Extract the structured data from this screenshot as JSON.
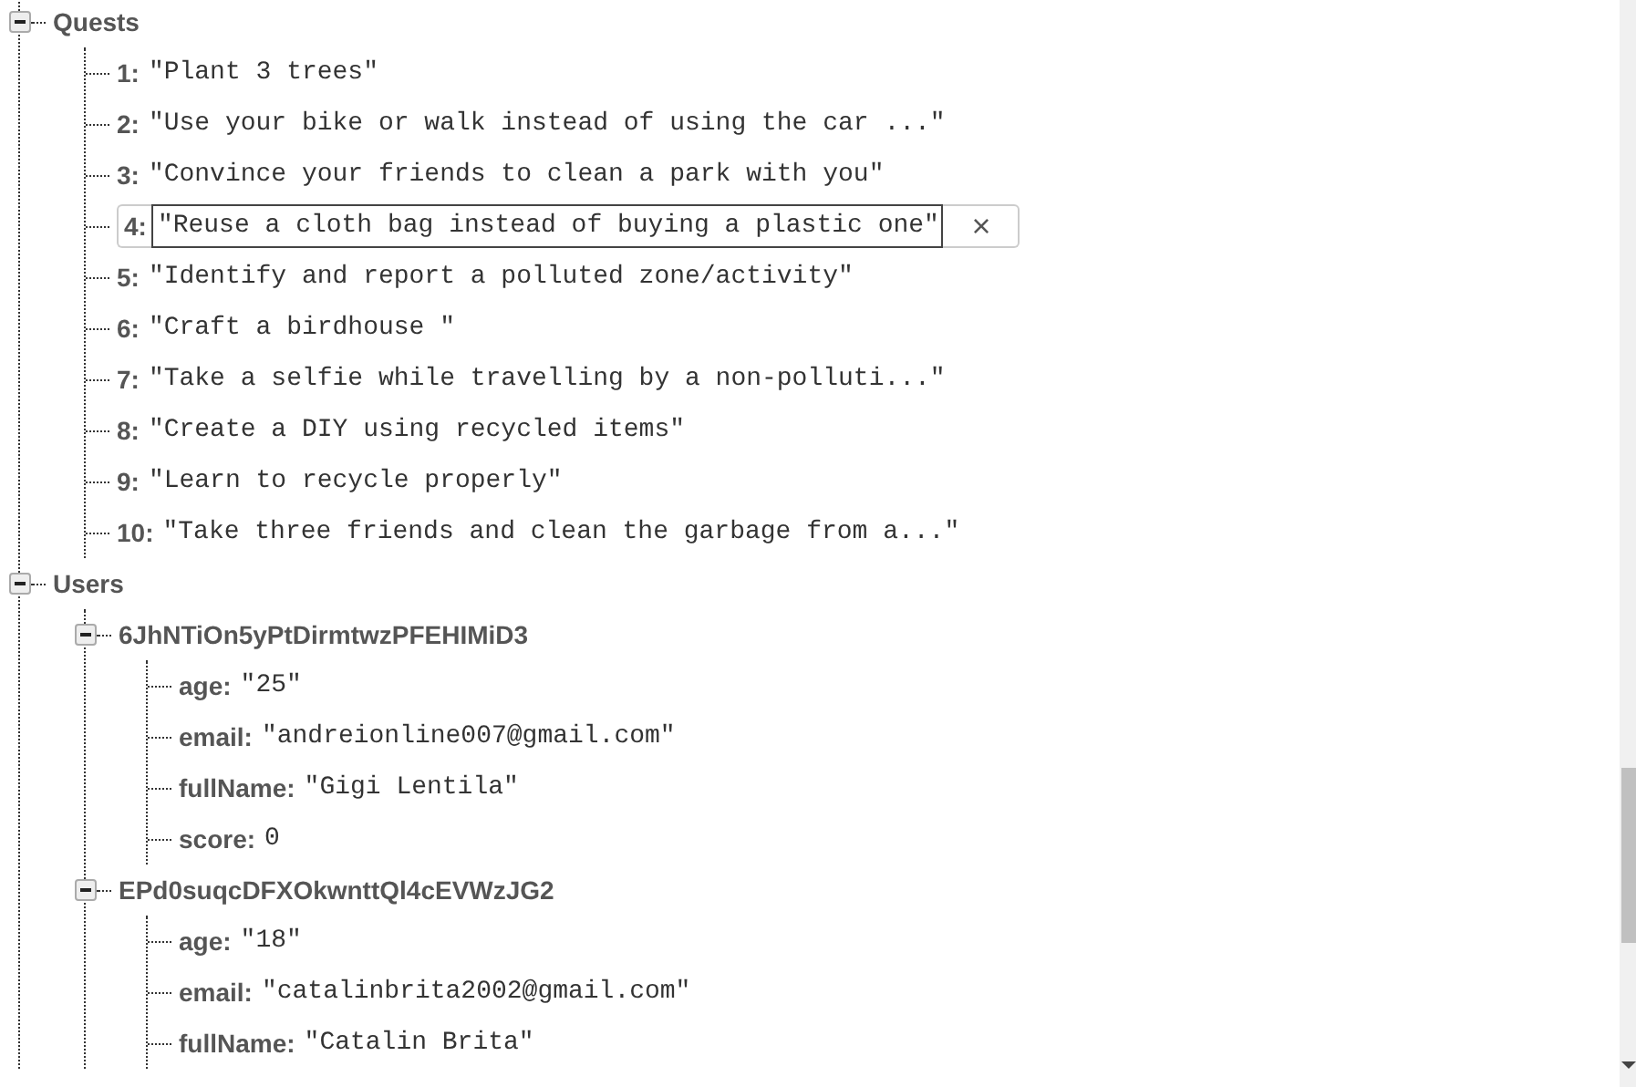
{
  "tree": [
    {
      "key": "Quests",
      "expanded": true,
      "children": [
        {
          "key": "1:",
          "value": "\"Plant 3 trees\"",
          "editing": false
        },
        {
          "key": "2:",
          "value": "\"Use your bike or walk instead of using the car ...\"",
          "editing": false
        },
        {
          "key": "3:",
          "value": "\"Convince your friends to clean a park with you\"",
          "editing": false
        },
        {
          "key": "4:",
          "value": "\"Reuse a cloth bag instead of buying a plastic one\"",
          "editing": true,
          "cancel": "×"
        },
        {
          "key": "5:",
          "value": "\"Identify and report a polluted zone/activity\"",
          "editing": false
        },
        {
          "key": "6:",
          "value": "\"Craft a birdhouse \"",
          "editing": false
        },
        {
          "key": "7:",
          "value": "\"Take a selfie while travelling by a non-polluti...\"",
          "editing": false
        },
        {
          "key": "8:",
          "value": "\"Create a DIY using recycled items\"",
          "editing": false
        },
        {
          "key": "9:",
          "value": "\"Learn to recycle properly\"",
          "editing": false
        },
        {
          "key": "10:",
          "value": "\"Take three friends and clean the garbage from a...\"",
          "editing": false
        }
      ]
    },
    {
      "key": "Users",
      "expanded": true,
      "children": [
        {
          "key": "6JhNTiOn5yPtDirmtwzPFEHIMiD3",
          "expanded": true,
          "children": [
            {
              "key": "age:",
              "value": "\"25\"",
              "editing": false
            },
            {
              "key": "email:",
              "value": "\"andreionline007@gmail.com\"",
              "editing": false
            },
            {
              "key": "fullName:",
              "value": "\"Gigi Lentila\"",
              "editing": false
            },
            {
              "key": "score:",
              "value": "0",
              "editing": false
            }
          ]
        },
        {
          "key": "EPd0suqcDFXOkwnttQl4cEVWzJG2",
          "expanded": true,
          "children": [
            {
              "key": "age:",
              "value": "\"18\"",
              "editing": false
            },
            {
              "key": "email:",
              "value": "\"catalinbrita2002@gmail.com\"",
              "editing": false
            },
            {
              "key": "fullName:",
              "value": "\"Catalin Brita\"",
              "editing": false
            }
          ]
        }
      ]
    }
  ]
}
